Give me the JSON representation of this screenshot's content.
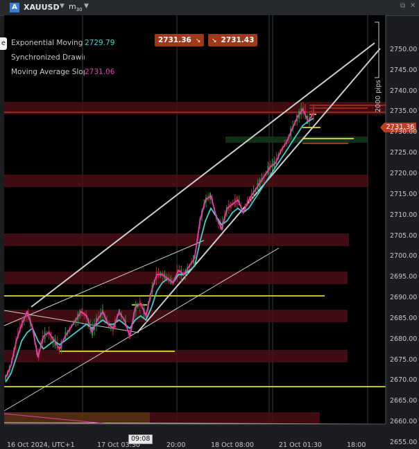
{
  "toolbar": {
    "symbol_badge": "A",
    "symbol": "XAUUSD",
    "symbol_dropdown": "▼",
    "timeframe": "m",
    "timeframe_sub": "30",
    "timeframe_dropdown": "▼"
  },
  "legend": [
    {
      "name": "Exponential Moving A",
      "value": "2729.79",
      "value_color": "#3fd3d0"
    },
    {
      "name": "Synchronized Drawin",
      "value": "",
      "value_color": "#c8c8c8"
    },
    {
      "name": "Moving Average Slope",
      "value": "2731.06",
      "value_color": "#e83ab7"
    }
  ],
  "left_stub": "e",
  "quote": {
    "sell": "2731.36",
    "sell_arrow": "↘",
    "buy": "2731.43",
    "buy_arrow": "↘"
  },
  "current_price": "2731.36",
  "pips_label": "2000 pips",
  "y_axis": [
    "2750.00",
    "2745.00",
    "2740.00",
    "2735.00",
    "2730.00",
    "2725.00",
    "2720.00",
    "2715.00",
    "2710.00",
    "2705.00",
    "2700.00",
    "2695.00",
    "2690.00",
    "2685.00",
    "2680.00",
    "2675.00",
    "2670.00",
    "2665.00",
    "2660.00",
    "2655.00"
  ],
  "x_axis": [
    "16 Oct 2024, UTC+1",
    "17 Oct 03:30",
    "20:00",
    "18 Oct 08:00",
    "21 Oct 01:30",
    "18:00"
  ],
  "crosshair_time": "09:08",
  "colors": {
    "accent": "#c23b22",
    "ema": "#3fd3d0",
    "ma_slope": "#e83ab7",
    "support": "#ffff33"
  },
  "chart_data": {
    "type": "line",
    "y_range": [
      2653.5,
      2753
    ],
    "series": [
      {
        "name": "Exponential Moving A",
        "values": [
          2666,
          2668,
          2672,
          2676,
          2678,
          2679,
          2676,
          2674,
          2675,
          2676,
          2675,
          2676,
          2677,
          2678,
          2679,
          2680,
          2679,
          2680,
          2681,
          2680,
          2680,
          2681,
          2680,
          2679,
          2681,
          2682,
          2681,
          2684,
          2688,
          2690,
          2691,
          2690,
          2692,
          2692,
          2693,
          2694,
          2700,
          2705,
          2708,
          2706,
          2704,
          2705,
          2707,
          2708,
          2707,
          2708,
          2710,
          2712,
          2714,
          2716,
          2718,
          2720,
          2722,
          2724,
          2726,
          2728,
          2729,
          2729.79
        ]
      },
      {
        "name": "Moving Average Slope",
        "values": [
          2667,
          2670,
          2676,
          2680,
          2683,
          2679,
          2672,
          2677,
          2678,
          2676,
          2674,
          2677,
          2679,
          2681,
          2683,
          2682,
          2678,
          2681,
          2683,
          2680,
          2679,
          2683,
          2681,
          2677,
          2684,
          2685,
          2682,
          2688,
          2692,
          2692,
          2691,
          2690,
          2693,
          2692,
          2694,
          2696,
          2705,
          2710,
          2711,
          2706,
          2703,
          2708,
          2709,
          2710,
          2707,
          2710,
          2712,
          2714,
          2716,
          2718,
          2719,
          2722,
          2724,
          2727,
          2730,
          2732,
          2729,
          2731.06
        ]
      }
    ]
  }
}
